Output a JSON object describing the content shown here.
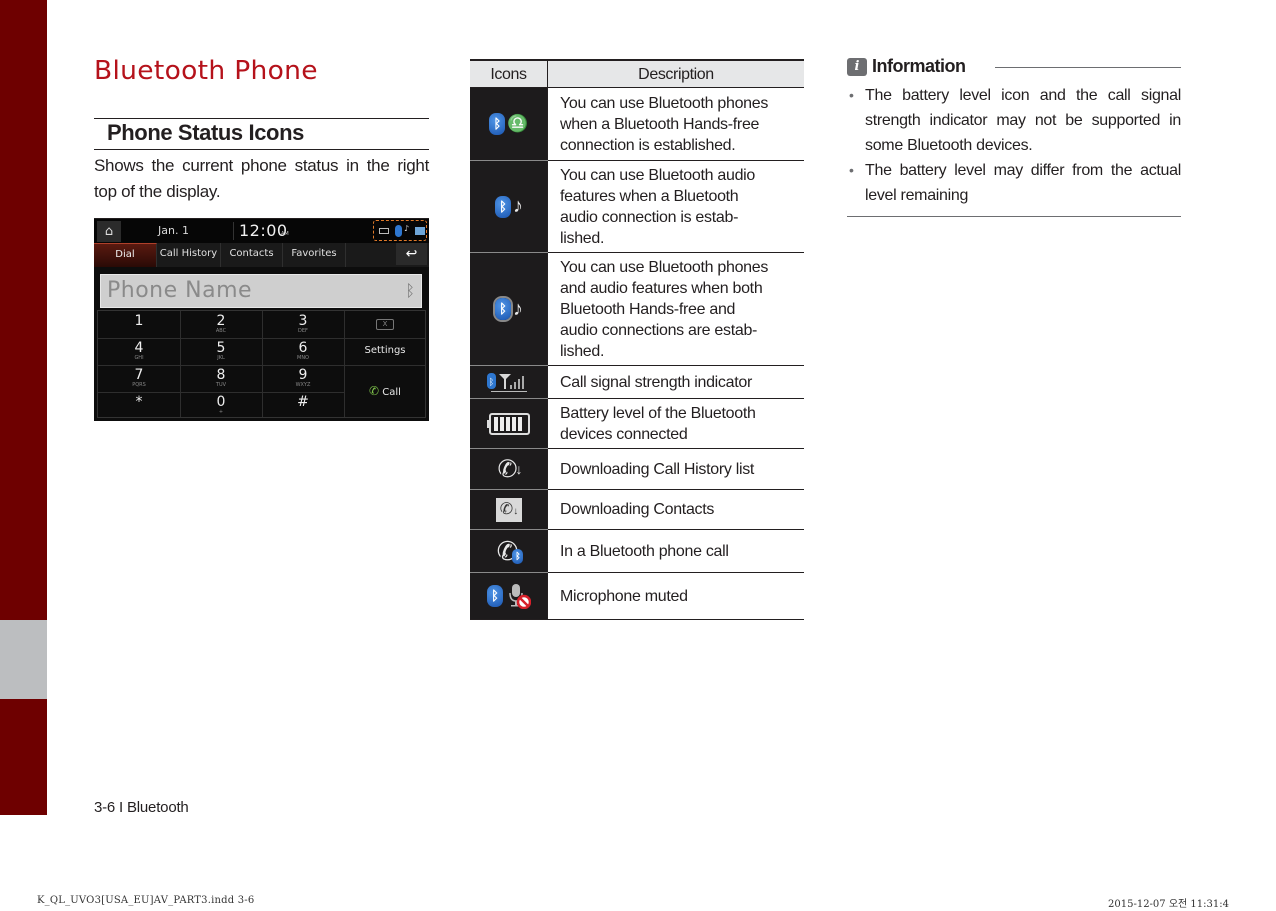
{
  "colors": {
    "sidebar": "#6e0000",
    "sidebar_tab": "#bcbec0",
    "title": "#b5121b",
    "table_header_bg": "#e6e7e8",
    "icon_cell_bg": "#1d1b1c"
  },
  "page_title": "Bluetooth Phone",
  "section": {
    "title": "Phone Status Icons",
    "body": "Shows the current phone status in the right top of the display."
  },
  "screen": {
    "home_icon": "home-icon",
    "date": "Jan.  1",
    "time": "12:00",
    "ampm": "AM",
    "tabs": [
      "Dial",
      "Call History",
      "Contacts",
      "Favorites"
    ],
    "active_tab": "Dial",
    "back_icon": "back-icon",
    "phone_name": "Phone Name",
    "keys": [
      {
        "num": "1",
        "sub": ""
      },
      {
        "num": "2",
        "sub": "ABC"
      },
      {
        "num": "3",
        "sub": "DEF"
      },
      {
        "num": "4",
        "sub": "GHI"
      },
      {
        "num": "5",
        "sub": "JKL"
      },
      {
        "num": "6",
        "sub": "MNO"
      },
      {
        "num": "7",
        "sub": "PQRS"
      },
      {
        "num": "8",
        "sub": "TUV"
      },
      {
        "num": "9",
        "sub": "WXYZ"
      },
      {
        "num": "*",
        "sub": ""
      },
      {
        "num": "0",
        "sub": "+"
      },
      {
        "num": "#",
        "sub": ""
      }
    ],
    "delete_label": "X",
    "settings_label": "Settings",
    "call_label": "Call"
  },
  "table": {
    "headers": {
      "icons": "Icons",
      "description": "Description"
    },
    "rows": [
      {
        "icon": "bluetooth-handsfree-icon",
        "lines": [
          "You can use Bluetooth phones",
          "when a Bluetooth Hands-free",
          "connection is established."
        ]
      },
      {
        "icon": "bluetooth-audio-icon",
        "lines": [
          "You can use Bluetooth audio",
          "features when a Bluetooth",
          "audio connection is estab-",
          "lished."
        ]
      },
      {
        "icon": "bluetooth-handsfree-audio-icon",
        "lines": [
          "You can use Bluetooth phones",
          "and audio features when both",
          "Bluetooth Hands-free and",
          "audio connections are estab-",
          "lished."
        ]
      },
      {
        "icon": "signal-strength-icon",
        "lines": [
          "Call signal strength indicator"
        ]
      },
      {
        "icon": "battery-level-icon",
        "lines": [
          "Battery level of the Bluetooth",
          "devices connected"
        ]
      },
      {
        "icon": "download-call-history-icon",
        "lines": [
          "Downloading Call History list"
        ]
      },
      {
        "icon": "download-contacts-icon",
        "lines": [
          "Downloading Contacts"
        ]
      },
      {
        "icon": "bluetooth-call-icon",
        "lines": [
          "In a Bluetooth phone call"
        ]
      },
      {
        "icon": "microphone-muted-icon",
        "lines": [
          "Microphone muted"
        ]
      }
    ]
  },
  "info": {
    "title": "Information",
    "items": [
      "The battery level icon and the call signal strength indicator may not be supported in some Bluetooth devices.",
      "The battery level may differ from the actual level remaining"
    ]
  },
  "footer": {
    "page_label": "3-6 I Bluetooth"
  },
  "slug": {
    "file": "K_QL_UVO3[USA_EU]AV_PART3.indd   3-6",
    "datetime": "2015-12-07   오전 11:31:4"
  }
}
